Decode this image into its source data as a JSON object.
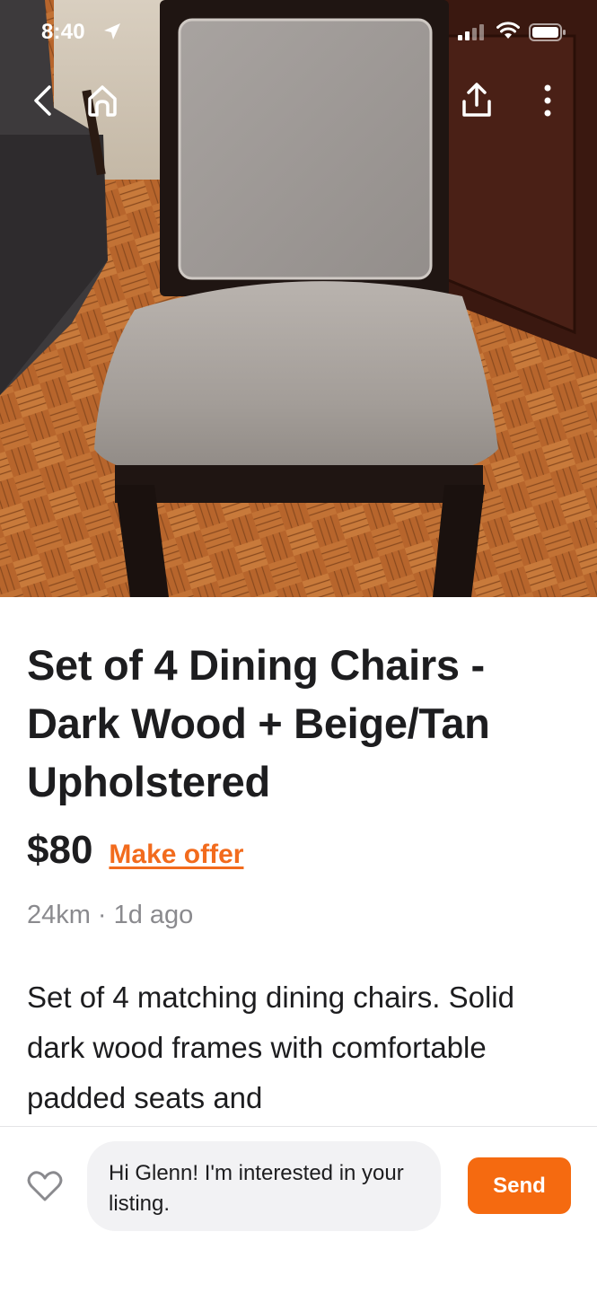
{
  "status_bar": {
    "time": "8:40",
    "location_icon": "location-arrow-icon",
    "signal_icon": "cellular-signal-icon",
    "wifi_icon": "wifi-icon",
    "battery_icon": "battery-icon"
  },
  "nav": {
    "back_icon": "chevron-left-icon",
    "home_icon": "home-icon",
    "share_icon": "share-icon",
    "more_icon": "more-vertical-icon"
  },
  "listing": {
    "photo": "chair-photo",
    "title": "Set of 4 Dining Chairs - Dark Wood + Beige/Tan Upholstered",
    "price": "$80",
    "make_offer": "Make offer",
    "distance": "24km",
    "separator": "·",
    "posted": "1d ago",
    "description": "Set of 4 matching dining chairs. Solid dark wood frames with comfortable padded seats and"
  },
  "message_bar": {
    "favorite_icon": "heart-icon",
    "message": "Hi Glenn! I'm interested in your listing.",
    "send_label": "Send"
  },
  "colors": {
    "accent": "#f26b1d",
    "send_button": "#f56a10",
    "muted_text": "#8a8a8e",
    "message_bg": "#f2f2f4"
  }
}
